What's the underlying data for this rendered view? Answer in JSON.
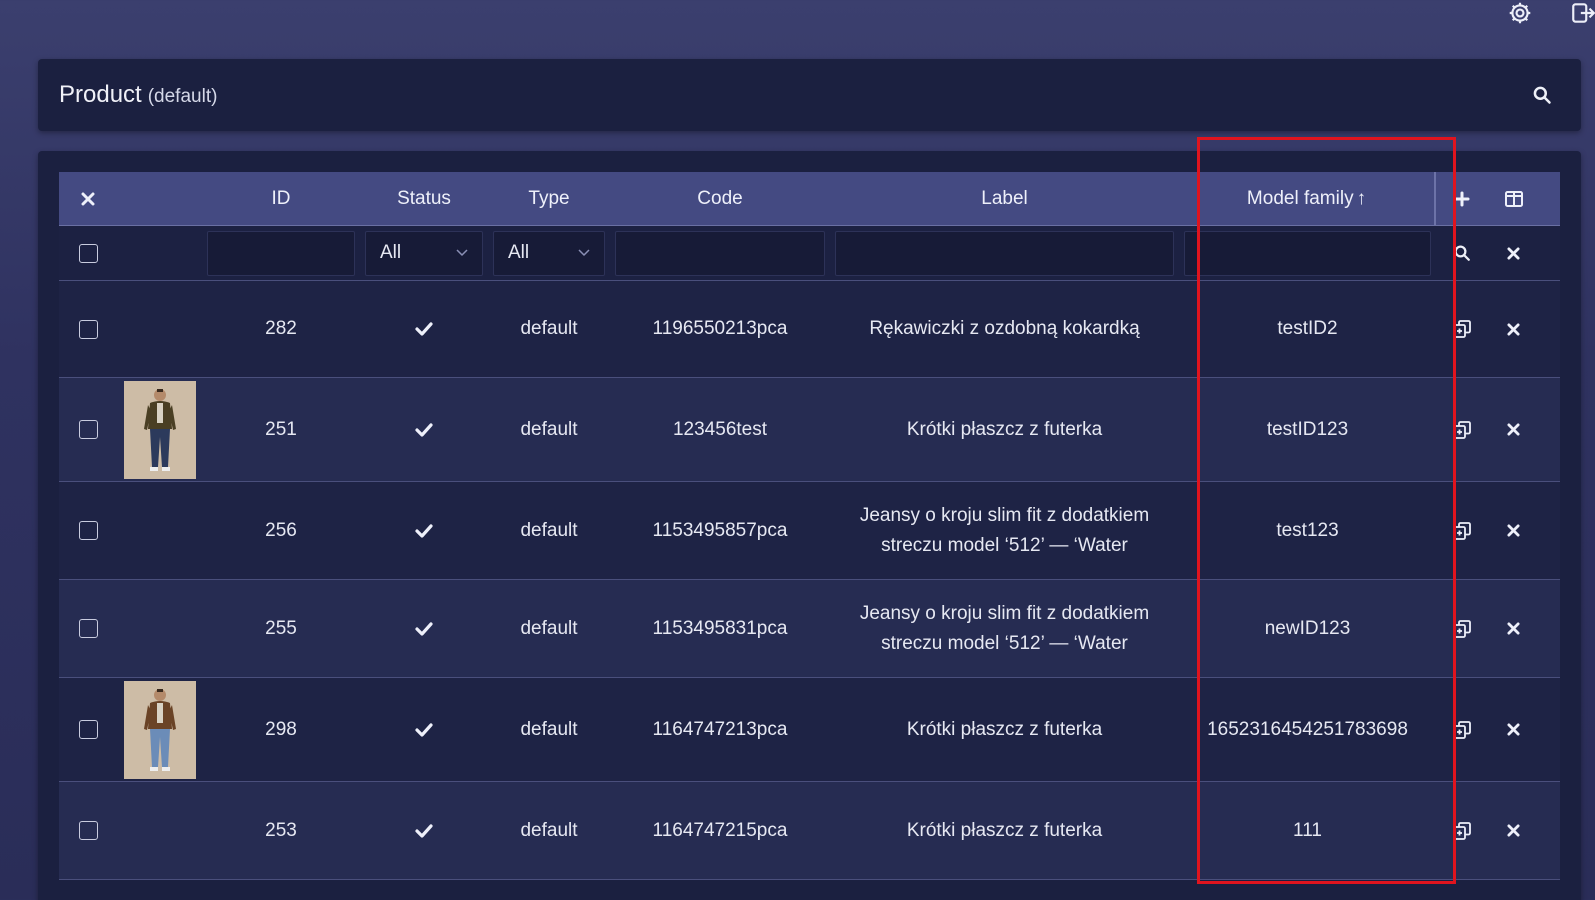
{
  "page": {
    "title": "Product",
    "subtitle": "(default)"
  },
  "table": {
    "columns": {
      "id": "ID",
      "status": "Status",
      "type": "Type",
      "code": "Code",
      "label": "Label",
      "model_family": "Model family",
      "sort_indicator": "↑"
    },
    "filters": {
      "status_value": "All",
      "type_value": "All"
    },
    "rows": [
      {
        "id": "282",
        "status": "enabled",
        "type": "default",
        "code": "1196550213pca",
        "label": "Rękawiczki z ozdobną kokardką",
        "model_family": "testID2",
        "has_image": false
      },
      {
        "id": "251",
        "status": "enabled",
        "type": "default",
        "code": "123456test",
        "label": "Krótki płaszcz z futerka",
        "model_family": "testID123",
        "has_image": true
      },
      {
        "id": "256",
        "status": "enabled",
        "type": "default",
        "code": "1153495857pca",
        "label": "Jeansy o kroju slim fit z dodatkiem streczu model ‘512’ — ‘Water",
        "model_family": "test123",
        "has_image": false
      },
      {
        "id": "255",
        "status": "enabled",
        "type": "default",
        "code": "1153495831pca",
        "label": "Jeansy o kroju slim fit z dodatkiem streczu model ‘512’ — ‘Water",
        "model_family": "newID123",
        "has_image": false
      },
      {
        "id": "298",
        "status": "enabled",
        "type": "default",
        "code": "1164747213pca",
        "label": "Krótki płaszcz z futerka",
        "model_family": "1652316454251783698",
        "has_image": true
      },
      {
        "id": "253",
        "status": "enabled",
        "type": "default",
        "code": "1164747215pca",
        "label": "Krótki płaszcz z futerka",
        "model_family": "111",
        "has_image": false
      }
    ]
  },
  "colors": {
    "background": "#2f3260",
    "card": "#1b2040",
    "header_row": "#444a82",
    "highlight": "#e0141e"
  },
  "icons": {
    "topbar": [
      "gear-icon",
      "logout-icon"
    ],
    "header": [
      "search-icon"
    ],
    "table_header": [
      "close-icon",
      "plus-icon",
      "columns-icon"
    ],
    "filter_row": [
      "search-icon",
      "close-icon"
    ],
    "row_actions": [
      "duplicate-icon",
      "delete-icon"
    ],
    "status": "check-icon"
  }
}
